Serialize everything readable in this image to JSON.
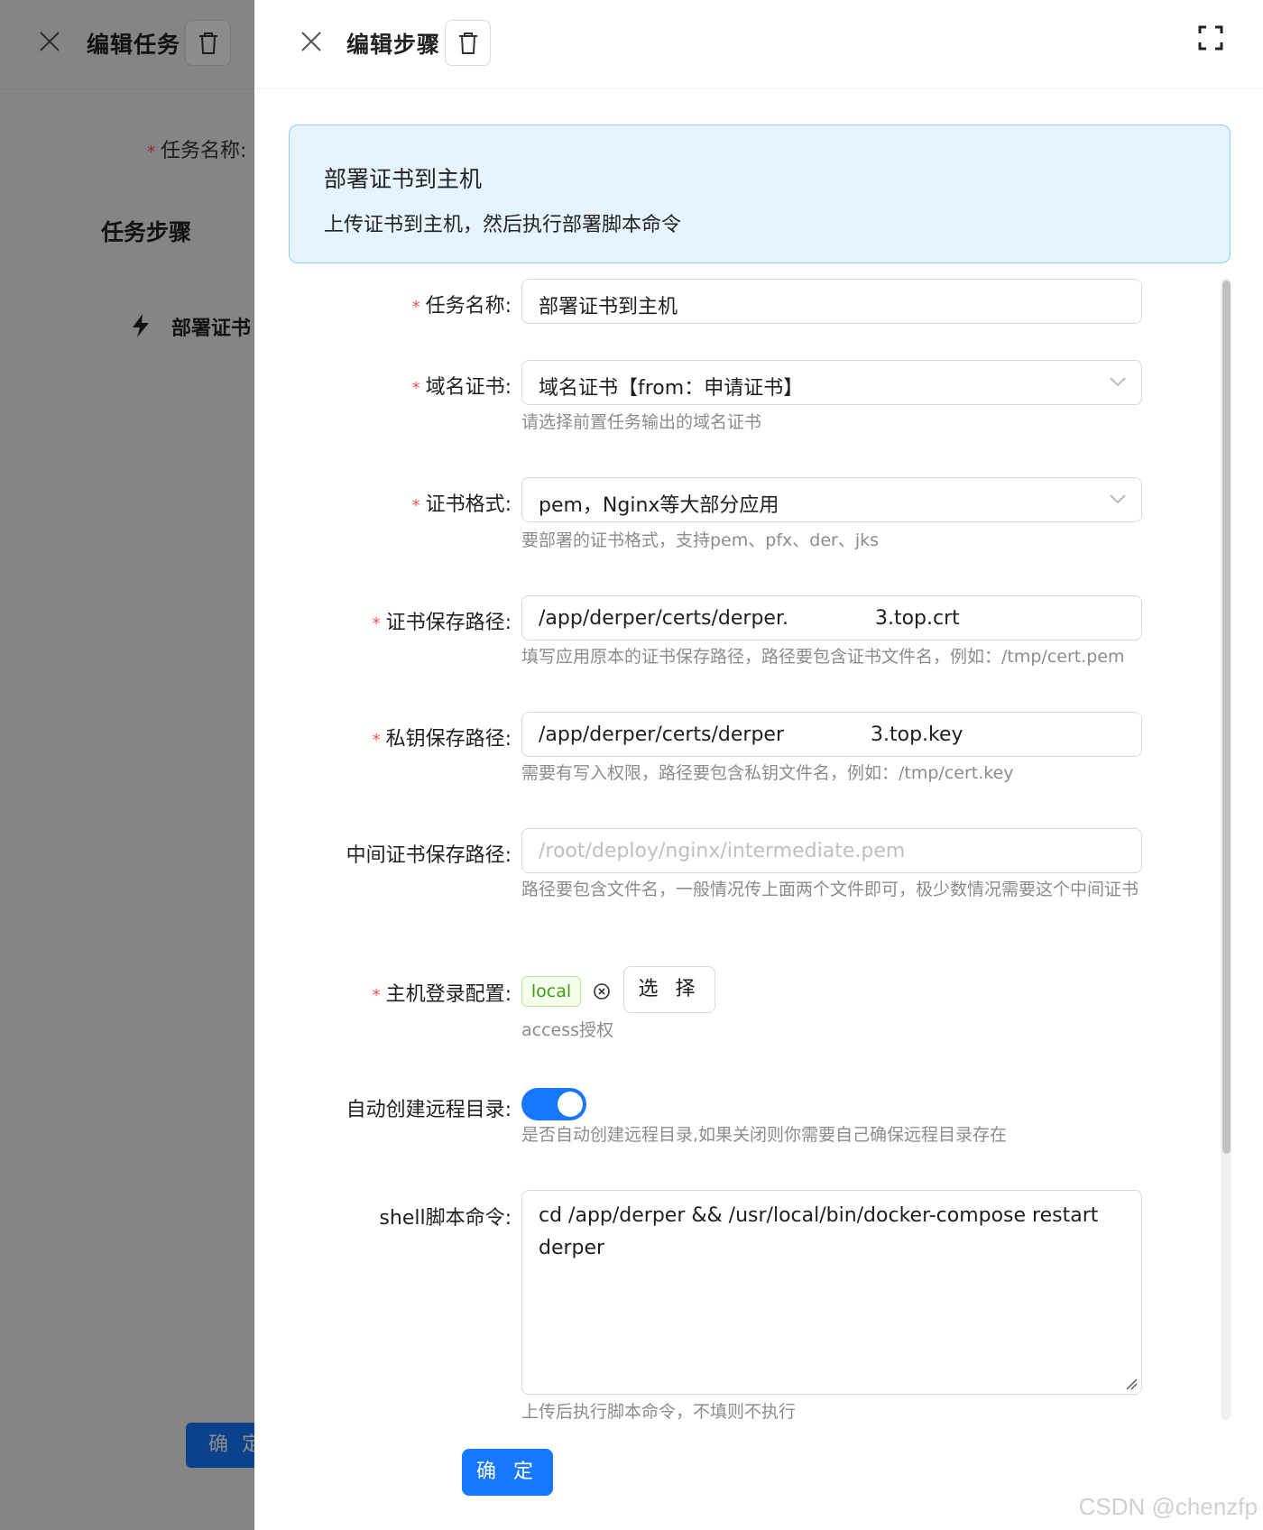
{
  "background_drawer": {
    "title": "编辑任务",
    "task_name_label": "任务名称:",
    "steps_section_title": "任务步骤",
    "step_name": "部署证书",
    "ok_label": "确 定"
  },
  "drawer": {
    "title": "编辑步骤",
    "info": {
      "title": "部署证书到主机",
      "description": "上传证书到主机，然后执行部署脚本命令"
    },
    "form": {
      "task_name": {
        "label": "任务名称:",
        "value": "部署证书到主机"
      },
      "domain_cert": {
        "label": "域名证书:",
        "value": "域名证书【from：申请证书】",
        "help": "请选择前置任务输出的域名证书"
      },
      "cert_format": {
        "label": "证书格式:",
        "value": "pem，Nginx等大部分应用",
        "help": "要部署的证书格式，支持pem、pfx、der、jks"
      },
      "cert_path": {
        "label": "证书保存路径:",
        "value_start": "/app/derper/certs/derper.",
        "value_end": "3.top.crt",
        "help": "填写应用原本的证书保存路径，路径要包含证书文件名，例如：/tmp/cert.pem"
      },
      "key_path": {
        "label": "私钥保存路径:",
        "value_start": "/app/derper/certs/derper",
        "value_end": "3.top.key",
        "help": "需要有写入权限，路径要包含私钥文件名，例如：/tmp/cert.key"
      },
      "intermediate_path": {
        "label": "中间证书保存路径:",
        "placeholder": "/root/deploy/nginx/intermediate.pem",
        "help": "路径要包含文件名，一般情况传上面两个文件即可，极少数情况需要这个中间证书"
      },
      "host_login": {
        "label": "主机登录配置:",
        "tag": "local",
        "select_label": "选 择",
        "help": "access授权"
      },
      "auto_mkdir": {
        "label": "自动创建远程目录:",
        "checked": true,
        "help": "是否自动创建远程目录,如果关闭则你需要自己确保远程目录存在"
      },
      "shell": {
        "label": "shell脚本命令:",
        "value": "cd /app/derper && /usr/local/bin/docker-compose restart derper",
        "help": "上传后执行脚本命令，不填则不执行"
      }
    },
    "ok_label": "确 定"
  },
  "watermark": "CSDN @chenzfp",
  "colors": {
    "primary": "#1677ff",
    "required": "#ff4d4f",
    "info_bg": "#e6f4ff",
    "tag_green": "#389e0d"
  }
}
